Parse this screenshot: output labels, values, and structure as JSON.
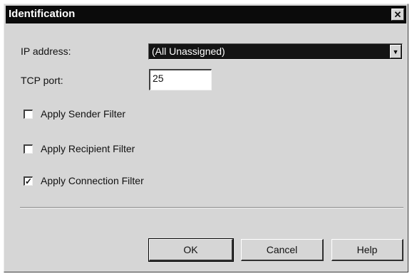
{
  "dialog": {
    "title": "Identification"
  },
  "ip_address": {
    "label": "IP address:",
    "value": "(All Unassigned)"
  },
  "tcp_port": {
    "label": "TCP port:",
    "value": "25"
  },
  "filters": [
    {
      "label": "Apply Sender Filter",
      "checked": false
    },
    {
      "label": "Apply Recipient Filter",
      "checked": false
    },
    {
      "label": "Apply Connection Filter",
      "checked": true
    }
  ],
  "buttons": {
    "ok": "OK",
    "cancel": "Cancel",
    "help": "Help"
  },
  "icons": {
    "close": "close-icon",
    "dropdown": "chevron-down-icon",
    "check": "checkmark-icon"
  }
}
